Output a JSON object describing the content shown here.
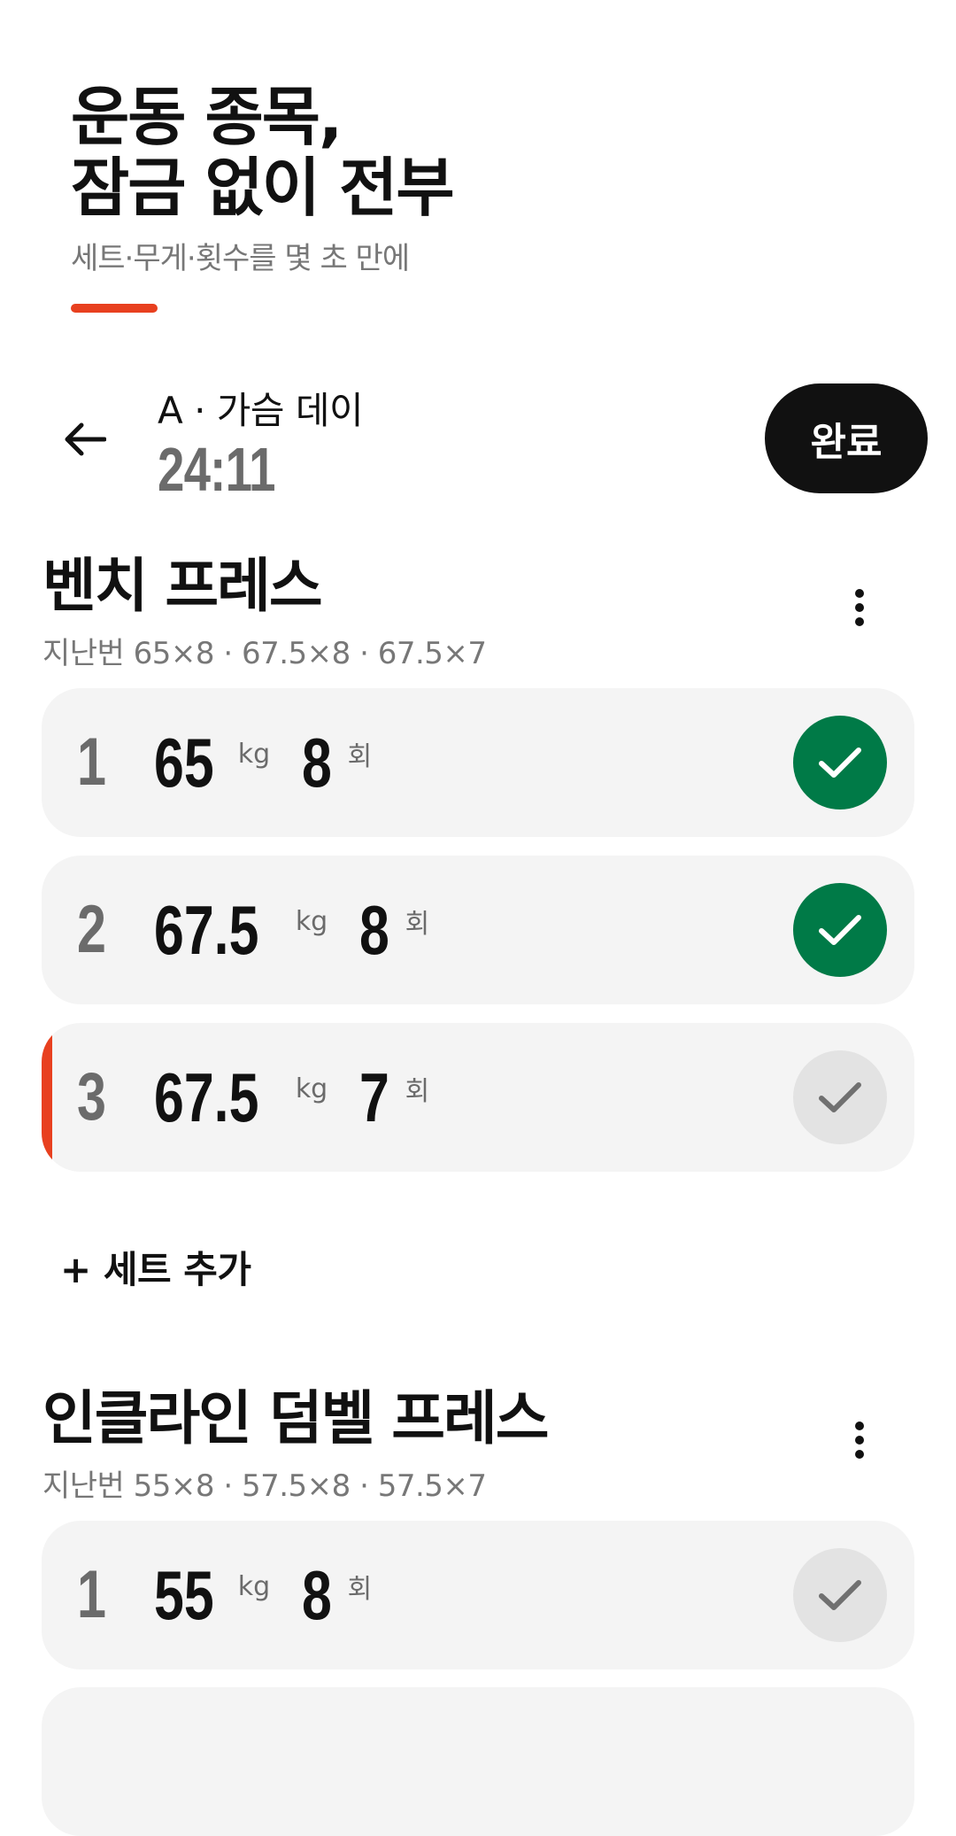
{
  "hero": {
    "title_line1": "운동 종목,",
    "title_line2": "잠금 없이 전부",
    "subtitle": "세트·무게·횟수를 몇 초 만에",
    "accent_color": "#e8401f"
  },
  "header": {
    "back_icon": "arrow-left-icon",
    "session_name": "A · 가슴 데이",
    "timer": "24:11",
    "done_label": "완료"
  },
  "exercises": [
    {
      "name": "벤치 프레스",
      "previous": "지난번 65×8 · 67.5×8 · 67.5×7",
      "menu_icon": "more-vertical-icon",
      "sets": [
        {
          "num": "1",
          "weight": "65",
          "weight_unit": "kg",
          "reps": "8",
          "reps_unit": "회",
          "completed": true
        },
        {
          "num": "2",
          "weight": "67.5",
          "weight_unit": "kg",
          "reps": "8",
          "reps_unit": "회",
          "completed": true
        },
        {
          "num": "3",
          "weight": "67.5",
          "weight_unit": "kg",
          "reps": "7",
          "reps_unit": "회",
          "completed": false,
          "active": true
        }
      ],
      "add_set_label": "+ 세트 추가"
    },
    {
      "name": "인클라인 덤벨 프레스",
      "previous": "지난번 55×8 · 57.5×8 · 57.5×7",
      "menu_icon": "more-vertical-icon",
      "sets": [
        {
          "num": "1",
          "weight": "55",
          "weight_unit": "kg",
          "reps": "8",
          "reps_unit": "회",
          "completed": false
        }
      ]
    }
  ],
  "colors": {
    "completed": "#007a47",
    "pending": "#e3e3e3",
    "active_marker": "#e8401f",
    "row_bg": "#f4f4f4"
  }
}
